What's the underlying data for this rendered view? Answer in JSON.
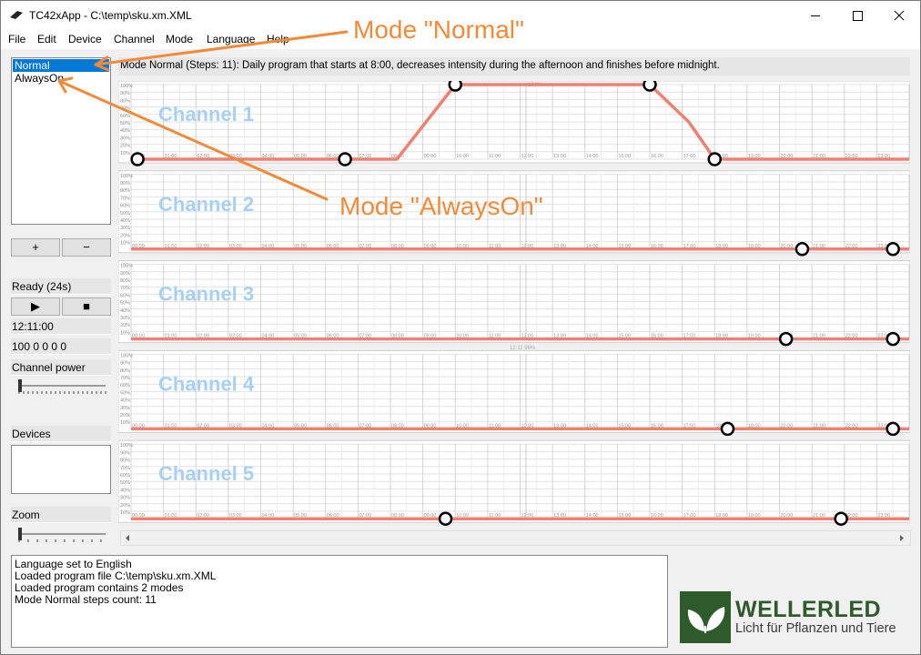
{
  "window": {
    "title": "TC42xApp - C:\\temp\\sku.xm.XML",
    "minimize_icon": "minimize-icon",
    "maximize_icon": "maximize-icon",
    "close_icon": "close-icon"
  },
  "menu": [
    "File",
    "Edit",
    "Device",
    "Channel",
    "Mode",
    "Language",
    "Help"
  ],
  "modes": [
    "Normal",
    "AlwaysOn"
  ],
  "buttons": {
    "add": "+",
    "remove": "−",
    "play": "▶",
    "stop": "■"
  },
  "status": {
    "text": "Ready (24s)",
    "clock": "12:11:00",
    "values": "100 0 0 0 0"
  },
  "labels": {
    "channel_power": "Channel power",
    "devices": "Devices",
    "zoom": "Zoom"
  },
  "description": "Mode Normal (Steps: 11): Daily program that starts at 8:00, decreases intensity during the afternoon and finishes before midnight.",
  "chart_data": {
    "type": "line",
    "x_ticks": [
      "00:00",
      "01:00",
      "02:00",
      "03:00",
      "04:00",
      "05:00",
      "06:00",
      "07:00",
      "08:00",
      "09:00",
      "10:00",
      "11:00",
      "12:00",
      "13:00",
      "14:00",
      "15:00",
      "16:00",
      "17:00",
      "18:00",
      "19:00",
      "20:00",
      "21:00",
      "22:00",
      "23:00"
    ],
    "y_ticks": [
      "100%",
      "90%",
      "80%",
      "70%",
      "60%",
      "50%",
      "40%",
      "30%",
      "20%",
      "10%"
    ],
    "xlim": [
      0,
      24
    ],
    "ylim": [
      0,
      100
    ],
    "cursor": {
      "time": 12.1833,
      "time_label": "12:11",
      "value_label": "96%",
      "top_label": "100%"
    },
    "series": [
      {
        "name": "Channel 1",
        "points": [
          [
            0,
            0
          ],
          [
            0.2,
            0
          ],
          [
            6.6,
            0
          ],
          [
            8.2,
            0
          ],
          [
            10,
            100
          ],
          [
            12,
            100
          ],
          [
            16,
            100
          ],
          [
            17.2,
            50
          ],
          [
            18,
            0
          ],
          [
            24,
            0
          ]
        ],
        "markers": [
          [
            0.2,
            0
          ],
          [
            6.6,
            0
          ],
          [
            10,
            100
          ],
          [
            16,
            100
          ],
          [
            18,
            0
          ]
        ]
      },
      {
        "name": "Channel 2",
        "points": [
          [
            0,
            0
          ],
          [
            24,
            0
          ]
        ],
        "markers": [
          [
            20.7,
            0
          ],
          [
            23.5,
            0
          ]
        ]
      },
      {
        "name": "Channel 3",
        "points": [
          [
            0,
            0
          ],
          [
            24,
            0
          ]
        ],
        "markers": [
          [
            20.2,
            0
          ],
          [
            23.5,
            0
          ]
        ]
      },
      {
        "name": "Channel 4",
        "points": [
          [
            0,
            0
          ],
          [
            24,
            0
          ]
        ],
        "markers": [
          [
            18.4,
            0
          ],
          [
            23.5,
            0
          ]
        ]
      },
      {
        "name": "Channel 5",
        "points": [
          [
            0,
            0
          ],
          [
            24,
            0
          ]
        ],
        "markers": [
          [
            9.7,
            0
          ],
          [
            21.9,
            0
          ]
        ]
      }
    ]
  },
  "log": [
    "Language set to English",
    "Loaded program file C:\\temp\\sku.xm.XML",
    "Loaded program contains 2 modes",
    "Mode Normal steps count: 11"
  ],
  "logo": {
    "title": "WELLERLED",
    "subtitle": "Licht für Pflanzen und Tiere"
  },
  "annotations": {
    "normal": "Mode \"Normal\"",
    "always": "Mode \"AlwaysOn\""
  },
  "colors": {
    "accent": "#0078d7",
    "curve": "#f08070",
    "channel_label": "#a8d0f4",
    "annotation": "#f28a3a",
    "logo_green": "#2e5a2c"
  }
}
